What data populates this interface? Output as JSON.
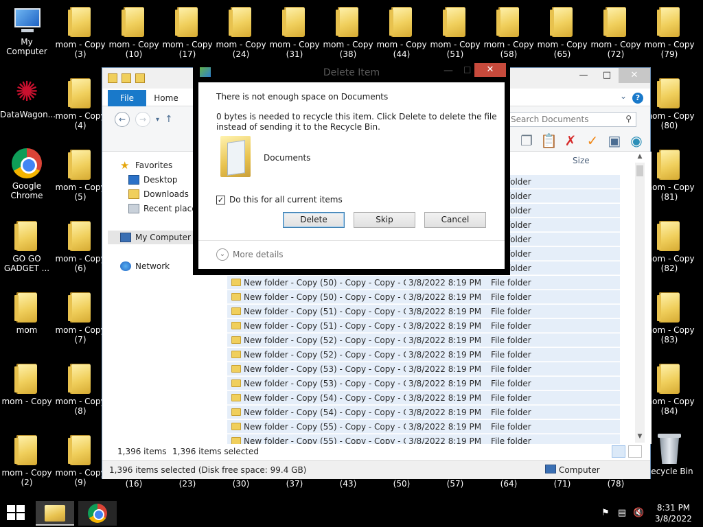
{
  "desktop": {
    "left_column": [
      {
        "label": "My Computer",
        "icon": "computer-icon"
      },
      {
        "label": "DataWagon...",
        "icon": "datawagon-icon"
      },
      {
        "label": "Google Chrome",
        "line1": "Google",
        "line2": "Chrome",
        "icon": "chrome-icon"
      },
      {
        "line1": "GO GO",
        "line2": "GADGET ...",
        "icon": "folder-icon"
      },
      {
        "label": "mom",
        "icon": "folder-icon"
      },
      {
        "label": "mom - Copy",
        "icon": "folder-icon"
      },
      {
        "line1": "mom - Copy",
        "line2": "(2)",
        "icon": "folder-icon"
      }
    ],
    "second_column": [
      {
        "line1": "mom - Copy",
        "line2": "(3)"
      },
      {
        "line1": "mom - Copy",
        "line2": "(4)"
      },
      {
        "line1": "mom - Copy",
        "line2": "(5)"
      },
      {
        "line1": "mom - Copy",
        "line2": "(6)"
      },
      {
        "line1": "mom - Copy",
        "line2": "(7)"
      },
      {
        "line1": "mom - Copy",
        "line2": "(8)"
      },
      {
        "line1": "mom - Copy",
        "line2": "(9)"
      }
    ],
    "top_row": [
      {
        "line1": "mom - Copy",
        "line2": "(10)"
      },
      {
        "line1": "mom - Copy",
        "line2": "(17)"
      },
      {
        "line1": "mom - Copy",
        "line2": "(24)"
      },
      {
        "line1": "mom - Copy",
        "line2": "(31)"
      },
      {
        "line1": "mom - Copy",
        "line2": "(38)"
      },
      {
        "line1": "mom - Copy",
        "line2": "(44)"
      },
      {
        "line1": "mom - Copy",
        "line2": "(51)"
      },
      {
        "line1": "mom - Copy",
        "line2": "(58)"
      },
      {
        "line1": "mom - Copy",
        "line2": "(65)"
      },
      {
        "line1": "mom - Copy",
        "line2": "(72)"
      },
      {
        "line1": "mom - Copy",
        "line2": "(79)"
      }
    ],
    "right_column": [
      {
        "line1": "mom - Copy",
        "line2": "(80)"
      },
      {
        "line1": "mom - Copy",
        "line2": "(81)"
      },
      {
        "line1": "mom - Copy",
        "line2": "(82)"
      },
      {
        "line1": "mom - Copy",
        "line2": "(83)"
      },
      {
        "line1": "mom - Copy",
        "line2": "(84)"
      },
      {
        "label": "Recycle Bin",
        "icon": "recycle-bin-icon"
      }
    ],
    "bottom_numbers": [
      "(16)",
      "(23)",
      "(30)",
      "(37)",
      "(43)",
      "(50)",
      "(57)",
      "(64)",
      "(71)",
      "(78)"
    ]
  },
  "explorer": {
    "tabs": {
      "file": "File",
      "home": "Home"
    },
    "search_placeholder": "Search Documents",
    "nav": {
      "favorites": "Favorites",
      "desktop": "Desktop",
      "downloads": "Downloads",
      "recent": "Recent places",
      "my_computer": "My Computer",
      "network": "Network"
    },
    "columns": {
      "size": "Size"
    },
    "partial_rows": [
      "File folder",
      "File folder",
      "File folder",
      "File folder",
      "File folder",
      "File folder",
      "File folder"
    ],
    "rows": [
      {
        "name": "New folder - Copy (50) - Copy - Copy - C...",
        "date": "3/8/2022 8:19 PM",
        "type": "File folder"
      },
      {
        "name": "New folder - Copy (50) - Copy - Copy - C...",
        "date": "3/8/2022 8:19 PM",
        "type": "File folder"
      },
      {
        "name": "New folder - Copy (51) - Copy - Copy - C...",
        "date": "3/8/2022 8:19 PM",
        "type": "File folder"
      },
      {
        "name": "New folder - Copy (51) - Copy - Copy - C...",
        "date": "3/8/2022 8:19 PM",
        "type": "File folder"
      },
      {
        "name": "New folder - Copy (52) - Copy - Copy - C...",
        "date": "3/8/2022 8:19 PM",
        "type": "File folder"
      },
      {
        "name": "New folder - Copy (52) - Copy - Copy - C...",
        "date": "3/8/2022 8:19 PM",
        "type": "File folder"
      },
      {
        "name": "New folder - Copy (53) - Copy - Copy - C...",
        "date": "3/8/2022 8:19 PM",
        "type": "File folder"
      },
      {
        "name": "New folder - Copy (53) - Copy - Copy - C...",
        "date": "3/8/2022 8:19 PM",
        "type": "File folder"
      },
      {
        "name": "New folder - Copy (54) - Copy - Copy - C...",
        "date": "3/8/2022 8:19 PM",
        "type": "File folder"
      },
      {
        "name": "New folder - Copy (54) - Copy - Copy - C...",
        "date": "3/8/2022 8:19 PM",
        "type": "File folder"
      },
      {
        "name": "New folder - Copy (55) - Copy - Copy - C...",
        "date": "3/8/2022 8:19 PM",
        "type": "File folder"
      },
      {
        "name": "New folder - Copy (55) - Copy - Copy - C...",
        "date": "3/8/2022 8:19 PM",
        "type": "File folder"
      }
    ],
    "status": {
      "items": "1,396 items",
      "selected": "1,396 items selected"
    },
    "bottom_status": {
      "text": "1,396 items selected (Disk free space: 99.4 GB)",
      "computer": "Computer"
    }
  },
  "dialog": {
    "title": "Delete Item",
    "heading": "There is not enough space on Documents",
    "message": "0 bytes is needed to recycle this item. Click Delete to delete the file instead of sending it to the Recycle Bin.",
    "item_name": "Documents",
    "checkbox_label": "Do this for all current items",
    "checkbox_checked": true,
    "buttons": {
      "delete": "Delete",
      "skip": "Skip",
      "cancel": "Cancel"
    },
    "more_details": "More details"
  },
  "taskbar": {
    "clock_time": "8:31 PM",
    "clock_date": "3/8/2022"
  },
  "colors": {
    "accent": "#1979ca",
    "selection": "#e5eef9",
    "close_red": "#c74a3c"
  }
}
